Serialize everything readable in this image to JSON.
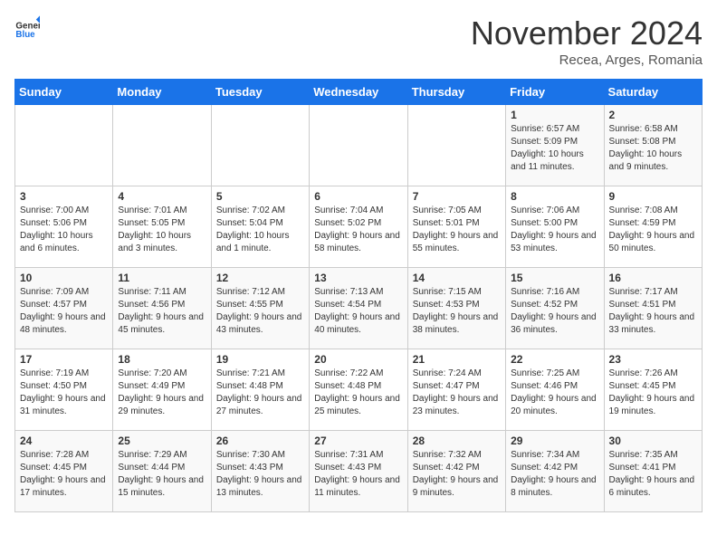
{
  "header": {
    "logo_general": "General",
    "logo_blue": "Blue",
    "month_title": "November 2024",
    "subtitle": "Recea, Arges, Romania"
  },
  "calendar": {
    "days_of_week": [
      "Sunday",
      "Monday",
      "Tuesday",
      "Wednesday",
      "Thursday",
      "Friday",
      "Saturday"
    ],
    "weeks": [
      [
        {
          "day": "",
          "info": ""
        },
        {
          "day": "",
          "info": ""
        },
        {
          "day": "",
          "info": ""
        },
        {
          "day": "",
          "info": ""
        },
        {
          "day": "",
          "info": ""
        },
        {
          "day": "1",
          "info": "Sunrise: 6:57 AM\nSunset: 5:09 PM\nDaylight: 10 hours and 11 minutes."
        },
        {
          "day": "2",
          "info": "Sunrise: 6:58 AM\nSunset: 5:08 PM\nDaylight: 10 hours and 9 minutes."
        }
      ],
      [
        {
          "day": "3",
          "info": "Sunrise: 7:00 AM\nSunset: 5:06 PM\nDaylight: 10 hours and 6 minutes."
        },
        {
          "day": "4",
          "info": "Sunrise: 7:01 AM\nSunset: 5:05 PM\nDaylight: 10 hours and 3 minutes."
        },
        {
          "day": "5",
          "info": "Sunrise: 7:02 AM\nSunset: 5:04 PM\nDaylight: 10 hours and 1 minute."
        },
        {
          "day": "6",
          "info": "Sunrise: 7:04 AM\nSunset: 5:02 PM\nDaylight: 9 hours and 58 minutes."
        },
        {
          "day": "7",
          "info": "Sunrise: 7:05 AM\nSunset: 5:01 PM\nDaylight: 9 hours and 55 minutes."
        },
        {
          "day": "8",
          "info": "Sunrise: 7:06 AM\nSunset: 5:00 PM\nDaylight: 9 hours and 53 minutes."
        },
        {
          "day": "9",
          "info": "Sunrise: 7:08 AM\nSunset: 4:59 PM\nDaylight: 9 hours and 50 minutes."
        }
      ],
      [
        {
          "day": "10",
          "info": "Sunrise: 7:09 AM\nSunset: 4:57 PM\nDaylight: 9 hours and 48 minutes."
        },
        {
          "day": "11",
          "info": "Sunrise: 7:11 AM\nSunset: 4:56 PM\nDaylight: 9 hours and 45 minutes."
        },
        {
          "day": "12",
          "info": "Sunrise: 7:12 AM\nSunset: 4:55 PM\nDaylight: 9 hours and 43 minutes."
        },
        {
          "day": "13",
          "info": "Sunrise: 7:13 AM\nSunset: 4:54 PM\nDaylight: 9 hours and 40 minutes."
        },
        {
          "day": "14",
          "info": "Sunrise: 7:15 AM\nSunset: 4:53 PM\nDaylight: 9 hours and 38 minutes."
        },
        {
          "day": "15",
          "info": "Sunrise: 7:16 AM\nSunset: 4:52 PM\nDaylight: 9 hours and 36 minutes."
        },
        {
          "day": "16",
          "info": "Sunrise: 7:17 AM\nSunset: 4:51 PM\nDaylight: 9 hours and 33 minutes."
        }
      ],
      [
        {
          "day": "17",
          "info": "Sunrise: 7:19 AM\nSunset: 4:50 PM\nDaylight: 9 hours and 31 minutes."
        },
        {
          "day": "18",
          "info": "Sunrise: 7:20 AM\nSunset: 4:49 PM\nDaylight: 9 hours and 29 minutes."
        },
        {
          "day": "19",
          "info": "Sunrise: 7:21 AM\nSunset: 4:48 PM\nDaylight: 9 hours and 27 minutes."
        },
        {
          "day": "20",
          "info": "Sunrise: 7:22 AM\nSunset: 4:48 PM\nDaylight: 9 hours and 25 minutes."
        },
        {
          "day": "21",
          "info": "Sunrise: 7:24 AM\nSunset: 4:47 PM\nDaylight: 9 hours and 23 minutes."
        },
        {
          "day": "22",
          "info": "Sunrise: 7:25 AM\nSunset: 4:46 PM\nDaylight: 9 hours and 20 minutes."
        },
        {
          "day": "23",
          "info": "Sunrise: 7:26 AM\nSunset: 4:45 PM\nDaylight: 9 hours and 19 minutes."
        }
      ],
      [
        {
          "day": "24",
          "info": "Sunrise: 7:28 AM\nSunset: 4:45 PM\nDaylight: 9 hours and 17 minutes."
        },
        {
          "day": "25",
          "info": "Sunrise: 7:29 AM\nSunset: 4:44 PM\nDaylight: 9 hours and 15 minutes."
        },
        {
          "day": "26",
          "info": "Sunrise: 7:30 AM\nSunset: 4:43 PM\nDaylight: 9 hours and 13 minutes."
        },
        {
          "day": "27",
          "info": "Sunrise: 7:31 AM\nSunset: 4:43 PM\nDaylight: 9 hours and 11 minutes."
        },
        {
          "day": "28",
          "info": "Sunrise: 7:32 AM\nSunset: 4:42 PM\nDaylight: 9 hours and 9 minutes."
        },
        {
          "day": "29",
          "info": "Sunrise: 7:34 AM\nSunset: 4:42 PM\nDaylight: 9 hours and 8 minutes."
        },
        {
          "day": "30",
          "info": "Sunrise: 7:35 AM\nSunset: 4:41 PM\nDaylight: 9 hours and 6 minutes."
        }
      ]
    ]
  }
}
